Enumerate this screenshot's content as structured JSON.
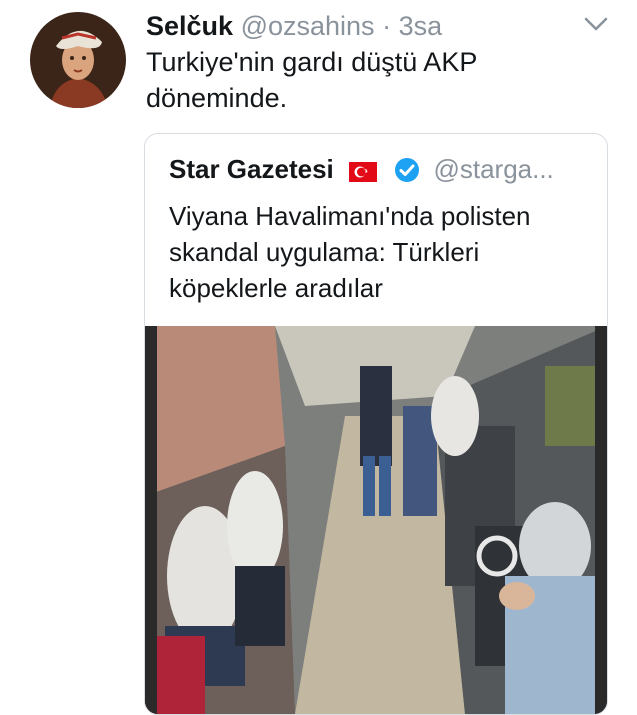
{
  "tweet": {
    "author_name": "Selčuk",
    "author_handle": "@ozsahins",
    "separator": "·",
    "time": "3sa",
    "text": "Turkiye'nin gardı düştü AKP döneminde.",
    "avatar_icon": "avatar-portrait",
    "menu_icon": "chevron-down-icon"
  },
  "quoted": {
    "author_name": "Star Gazetesi",
    "author_handle": "@starga...",
    "flag_icon": "turkey-flag-icon",
    "verified_icon": "verified-badge-icon",
    "text": "Viyana Havalimanı'nda polisten skandal uygulama: Türkleri köpeklerle aradılar",
    "media_type": "video-thumbnail"
  },
  "colors": {
    "text": "#14171a",
    "muted": "#8a939c",
    "border": "#d8dde2",
    "verified": "#1da1f2",
    "flag": "#e30a17"
  }
}
